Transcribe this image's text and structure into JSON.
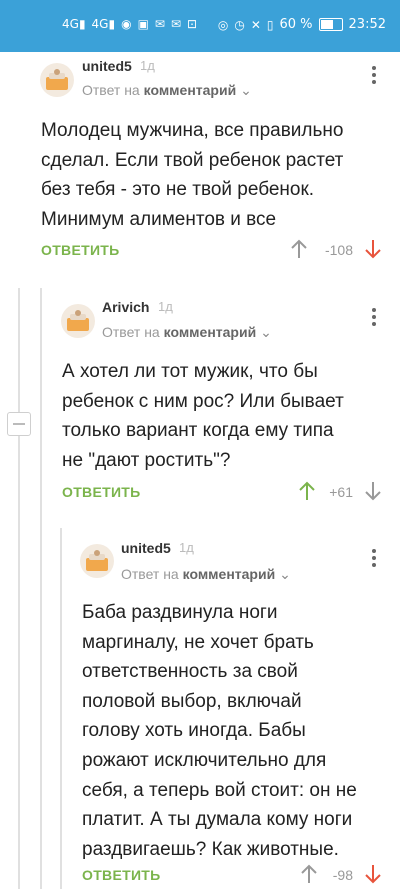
{
  "status_bar": {
    "left_icons": [
      "signal-4g-icon",
      "signal-4g-icon",
      "wifi-icon",
      "notification-icon",
      "mail-icon",
      "mail-icon",
      "search-app-icon"
    ],
    "left_labels": [
      "4G",
      "4G"
    ],
    "battery_percent": "60 %",
    "time": "23:52"
  },
  "comments": [
    {
      "author": "united5",
      "age": "1д",
      "reply_prefix": "Ответ на",
      "reply_target": "комментарий",
      "text_lines": [
        "Молодец мужчина, все правильно",
        "сделал.  Если твой ребенок растет",
        "без тебя - это не твой ребенок.",
        "Минимум алиментов и все"
      ],
      "reply_label": "ОТВЕТИТЬ",
      "score": "-108",
      "vote_state": "down"
    },
    {
      "author": "Arivich",
      "age": "1д",
      "reply_prefix": "Ответ на",
      "reply_target": "комментарий",
      "text_lines": [
        "А хотел ли тот мужик, что бы",
        "ребенок с ним рос? Или бывает",
        "только вариант когда ему типа",
        "не \"дают ростить\"?"
      ],
      "reply_label": "ОТВЕТИТЬ",
      "score": "+61",
      "vote_state": "up"
    },
    {
      "author": "united5",
      "age": "1д",
      "reply_prefix": "Ответ на",
      "reply_target": "комментарий",
      "text_lines": [
        "Баба раздвинула ноги",
        "маргиналу, не хочет брать",
        "ответственность за свой",
        "половой выбор, включай",
        "голову хоть иногда. Бабы",
        "рожают исключительно для",
        "себя, а теперь вой стоит: он не",
        "платит. А ты думала кому ноги",
        "раздвигаешь? Как животные."
      ],
      "reply_label": "ОТВЕТИТЬ",
      "score": "-98",
      "vote_state": "down"
    }
  ],
  "colors": {
    "status_bar": "#3ba1d8",
    "reply_green": "#7bb44c",
    "vote_up_active": "#7bb44c",
    "vote_down_active": "#e8543c",
    "vote_inactive": "#999999"
  }
}
